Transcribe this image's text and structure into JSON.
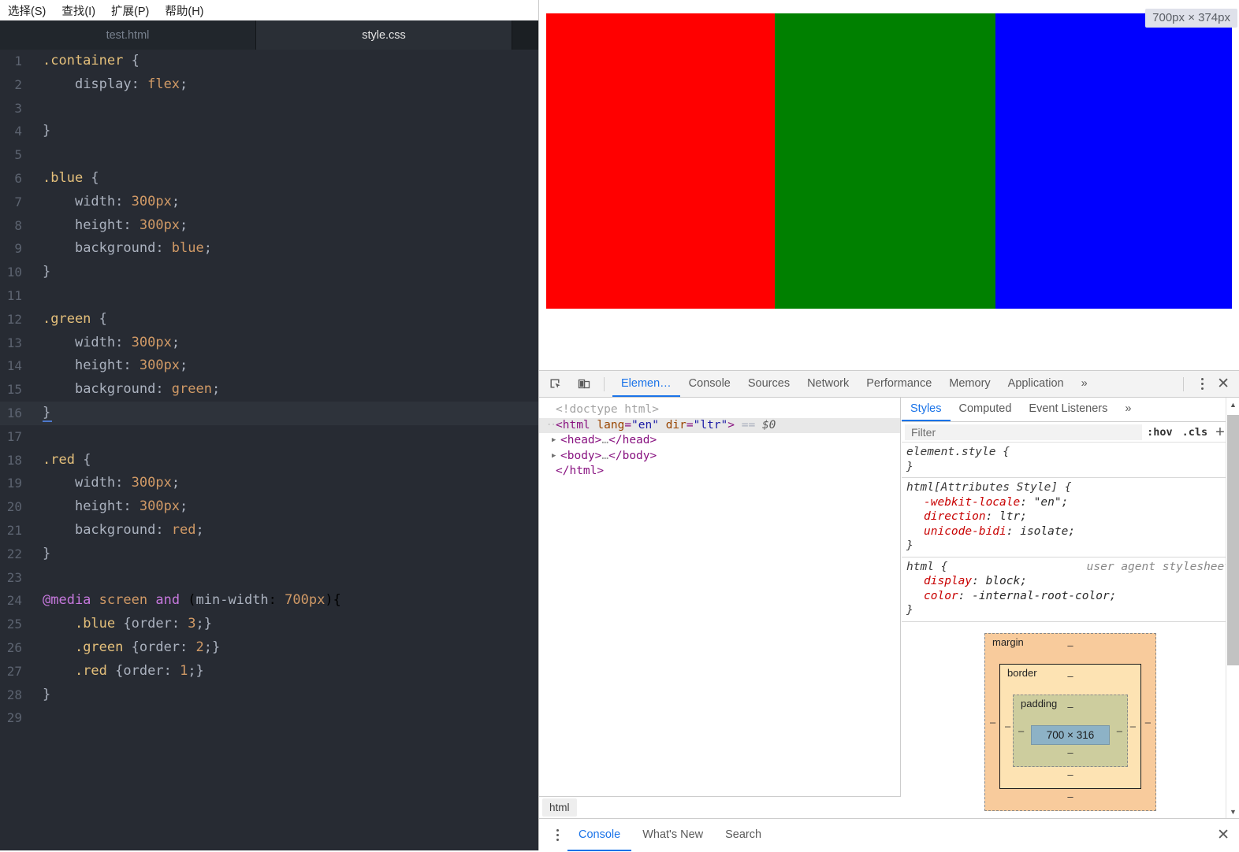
{
  "editor": {
    "menu": [
      {
        "label": "选择(S)"
      },
      {
        "label": "查找(I)"
      },
      {
        "label": "扩展(P)"
      },
      {
        "label": "帮助(H)"
      }
    ],
    "tabs": [
      {
        "label": "test.html",
        "active": false
      },
      {
        "label": "style.css",
        "active": true
      }
    ],
    "active_line": 16,
    "lines": [
      {
        "n": "1",
        "text": ".container {"
      },
      {
        "n": "2",
        "text": "    display: flex;"
      },
      {
        "n": "3",
        "text": ""
      },
      {
        "n": "4",
        "text": "}"
      },
      {
        "n": "5",
        "text": ""
      },
      {
        "n": "6",
        "text": ".blue {"
      },
      {
        "n": "7",
        "text": "    width: 300px;"
      },
      {
        "n": "8",
        "text": "    height: 300px;"
      },
      {
        "n": "9",
        "text": "    background: blue;"
      },
      {
        "n": "10",
        "text": "}"
      },
      {
        "n": "11",
        "text": ""
      },
      {
        "n": "12",
        "text": ".green {"
      },
      {
        "n": "13",
        "text": "    width: 300px;"
      },
      {
        "n": "14",
        "text": "    height: 300px;"
      },
      {
        "n": "15",
        "text": "    background: green;"
      },
      {
        "n": "16",
        "text": "}"
      },
      {
        "n": "17",
        "text": ""
      },
      {
        "n": "18",
        "text": ".red {"
      },
      {
        "n": "19",
        "text": "    width: 300px;"
      },
      {
        "n": "20",
        "text": "    height: 300px;"
      },
      {
        "n": "21",
        "text": "    background: red;"
      },
      {
        "n": "22",
        "text": "}"
      },
      {
        "n": "23",
        "text": ""
      },
      {
        "n": "24",
        "text": "@media screen and (min-width: 700px){"
      },
      {
        "n": "25",
        "text": "    .blue {order: 3;}"
      },
      {
        "n": "26",
        "text": "    .green {order: 2;}"
      },
      {
        "n": "27",
        "text": "    .red {order: 1;}"
      },
      {
        "n": "28",
        "text": "}"
      },
      {
        "n": "29",
        "text": ""
      }
    ]
  },
  "browser": {
    "size_tooltip": "700px × 374px",
    "blocks": [
      {
        "name": "red",
        "color": "#ff0000",
        "flex": "300"
      },
      {
        "name": "green",
        "color": "#008000",
        "flex": "290"
      },
      {
        "name": "blue",
        "color": "#0000ff",
        "flex": "310"
      }
    ]
  },
  "devtools": {
    "toolbar": {
      "inspect_icon": "inspect-element-icon",
      "device_icon": "device-toolbar-icon",
      "more_tabs": "»",
      "close": "✕",
      "tabs": [
        {
          "label": "Elemen…",
          "active": true
        },
        {
          "label": "Console",
          "active": false
        },
        {
          "label": "Sources",
          "active": false
        },
        {
          "label": "Network",
          "active": false
        },
        {
          "label": "Performance",
          "active": false
        },
        {
          "label": "Memory",
          "active": false
        },
        {
          "label": "Application",
          "active": false
        }
      ]
    },
    "dom": {
      "nodes": [
        {
          "indent": 0,
          "arrow": "",
          "parts": [
            {
              "t": "comment",
              "v": "<!doctype html>"
            }
          ],
          "highlight": false
        },
        {
          "indent": 0,
          "arrow": "…",
          "parts": [
            {
              "t": "br",
              "v": "<"
            },
            {
              "t": "tag",
              "v": "html"
            },
            {
              "t": "attr",
              "v": " lang"
            },
            {
              "t": "br",
              "v": "="
            },
            {
              "t": "aval",
              "v": "\"en\""
            },
            {
              "t": "attr",
              "v": " dir"
            },
            {
              "t": "br",
              "v": "="
            },
            {
              "t": "aval",
              "v": "\"ltr\""
            },
            {
              "t": "br",
              "v": ">"
            },
            {
              "t": "plain",
              "v": " == "
            },
            {
              "t": "dollar",
              "v": "$0"
            }
          ],
          "highlight": true
        },
        {
          "indent": 1,
          "arrow": "▶",
          "parts": [
            {
              "t": "br",
              "v": "<"
            },
            {
              "t": "tag",
              "v": "head"
            },
            {
              "t": "br",
              "v": ">"
            },
            {
              "t": "dots",
              "v": "…"
            },
            {
              "t": "br",
              "v": "</"
            },
            {
              "t": "tag",
              "v": "head"
            },
            {
              "t": "br",
              "v": ">"
            }
          ],
          "highlight": false
        },
        {
          "indent": 1,
          "arrow": "▶",
          "parts": [
            {
              "t": "br",
              "v": "<"
            },
            {
              "t": "tag",
              "v": "body"
            },
            {
              "t": "br",
              "v": ">"
            },
            {
              "t": "dots",
              "v": "…"
            },
            {
              "t": "br",
              "v": "</"
            },
            {
              "t": "tag",
              "v": "body"
            },
            {
              "t": "br",
              "v": ">"
            }
          ],
          "highlight": false
        },
        {
          "indent": 0,
          "arrow": "",
          "parts": [
            {
              "t": "br",
              "v": "</"
            },
            {
              "t": "tag",
              "v": "html"
            },
            {
              "t": "br",
              "v": ">"
            }
          ],
          "highlight": false
        }
      ],
      "breadcrumb": [
        "html"
      ]
    },
    "styles": {
      "tabs": [
        {
          "label": "Styles",
          "active": true
        },
        {
          "label": "Computed",
          "active": false
        },
        {
          "label": "Event Listeners",
          "active": false
        }
      ],
      "more_tabs": "»",
      "filter_placeholder": "Filter",
      "filter_value": "",
      "toggles": [
        ":hov",
        ".cls"
      ],
      "new_rule": "+",
      "rules": [
        {
          "selector": "element.style {",
          "origin": "",
          "declarations": [],
          "close": "}"
        },
        {
          "selector": "html[Attributes Style] {",
          "origin": "",
          "declarations": [
            {
              "prop": "-webkit-locale",
              "value": "\"en\";"
            },
            {
              "prop": "direction",
              "value": "ltr;"
            },
            {
              "prop": "unicode-bidi",
              "value": "isolate;"
            }
          ],
          "close": "}"
        },
        {
          "selector": "html {",
          "origin": "user agent stylesheet",
          "declarations": [
            {
              "prop": "display",
              "value": "block;"
            },
            {
              "prop": "color",
              "value": "-internal-root-color;"
            }
          ],
          "close": "}"
        }
      ],
      "box_model": {
        "margin_label": "margin",
        "border_label": "border",
        "padding_label": "padding",
        "content": "700 × 316",
        "dash": "‒"
      }
    },
    "drawer": {
      "menu_icon": "kebab-menu-icon",
      "tabs": [
        {
          "label": "Console",
          "active": true
        },
        {
          "label": "What's New",
          "active": false
        },
        {
          "label": "Search",
          "active": false
        }
      ],
      "close": "✕"
    }
  }
}
